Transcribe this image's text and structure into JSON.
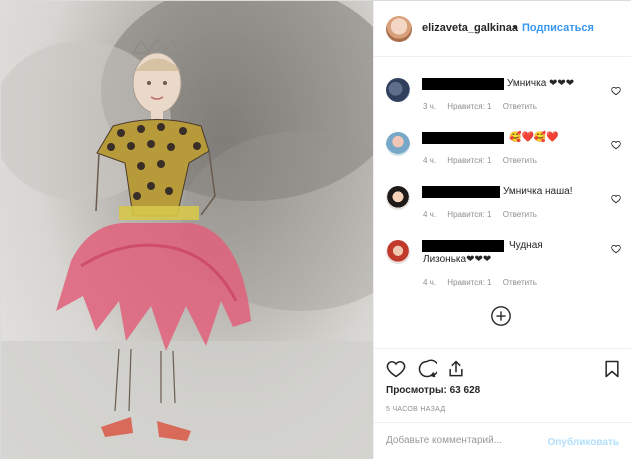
{
  "post": {
    "username": "elizaveta_galkinaa",
    "separator": "•",
    "follow_label": "Подписаться",
    "views_label": "Просмотры: 63 628",
    "time_ago": "5 ЧАСОВ НАЗАД"
  },
  "comments": [
    {
      "text": "Умничка ❤❤❤",
      "age": "3 ч.",
      "likes": "Нравится: 1",
      "reply": "Ответить"
    },
    {
      "text": "🥰❤️🥰❤️",
      "age": "4 ч.",
      "likes": "Нравится: 1",
      "reply": "Ответить"
    },
    {
      "text": "Умничка наша!",
      "age": "4 ч.",
      "likes": "Нравится: 1",
      "reply": "Ответить"
    },
    {
      "text_line1": "Чудная",
      "text_line2": "Лизонька❤❤❤",
      "age": "4 ч.",
      "likes": "Нравится: 1",
      "reply": "Ответить"
    }
  ],
  "add_comment": {
    "placeholder": "Добавьте комментарий...",
    "publish_label": "Опубликовать"
  },
  "icons": {
    "like": "heart-icon",
    "comment": "comment-icon",
    "share": "share-icon",
    "save": "bookmark-icon",
    "more": "plus-circle-icon"
  },
  "colors": {
    "accent": "#3897f0",
    "publish_disabled": "#b2dffc",
    "muted": "#8e8e8e"
  }
}
